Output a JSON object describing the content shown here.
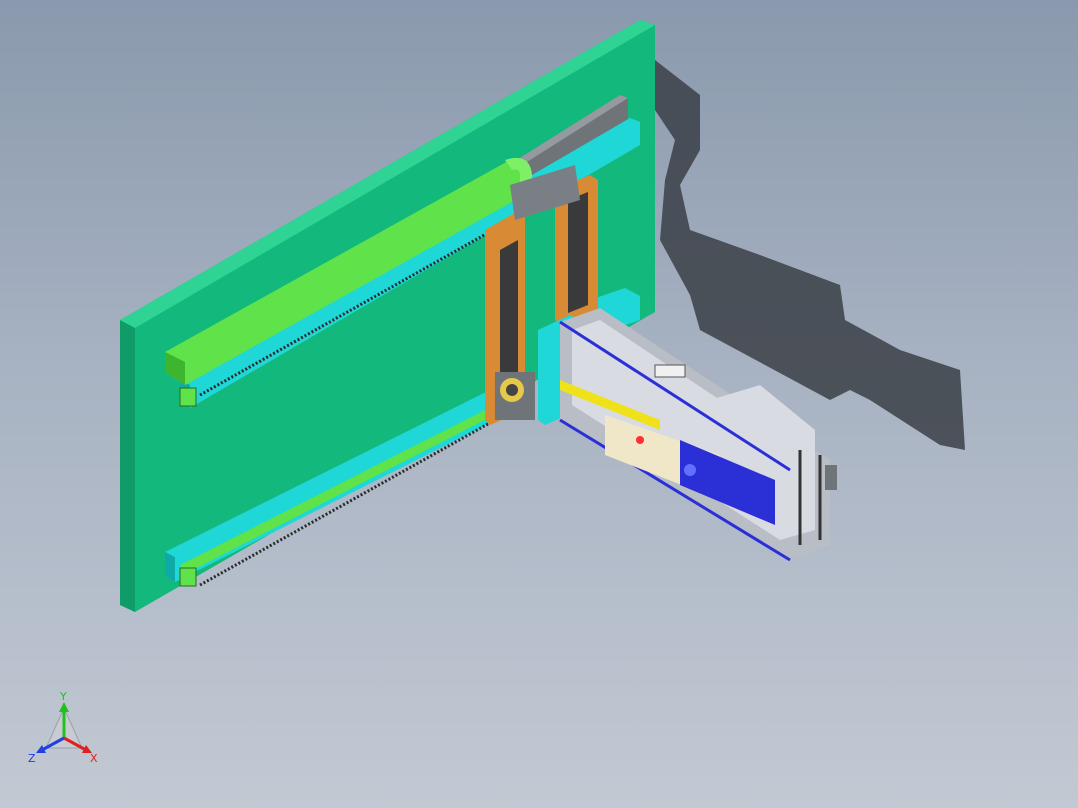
{
  "viewport": {
    "background_top": "#8a99ad",
    "background_bottom": "#c2c9d3"
  },
  "model": {
    "colors": {
      "backplate": "#13b97c",
      "backplate_side": "#0f9c68",
      "rail_cyan": "#1fd7d6",
      "rail_green": "#5fe24a",
      "rail_dark": "#6f7478",
      "column_orange": "#d98a35",
      "frame_grey": "#b8bdc6",
      "frame_blue": "#2b2fd6",
      "frame_yellow": "#f0e21a",
      "panel_cream": "#f0e6c8",
      "shadow": "#3b4047"
    }
  },
  "triad": {
    "x_label": "X",
    "y_label": "Y",
    "z_label": "Z",
    "x_color": "#e02020",
    "y_color": "#20c020",
    "z_color": "#2040e0"
  }
}
